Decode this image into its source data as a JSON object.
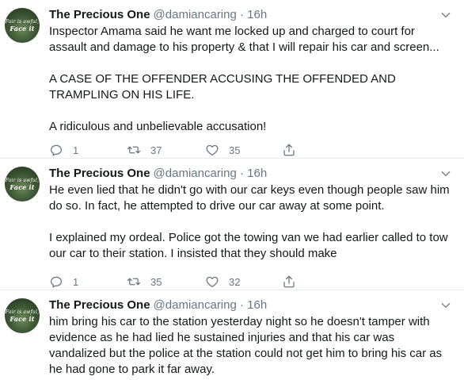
{
  "tweets": [
    {
      "name": "The Precious One",
      "handle": "@damiancaring",
      "separator": "·",
      "time": "16h",
      "paragraphs": [
        "Inspector Amama said he want me locked up and charged to court for assault and damage to his property & that I will repair his car and screen...",
        "A CASE OF THE OFFENDER ACCUSING THE OFFENDED AND TRAMPLING ON HIS LIFE.",
        "A ridiculous and unbelievable accusation!"
      ],
      "replies": "1",
      "retweets": "37",
      "likes": "35"
    },
    {
      "name": "The Precious One",
      "handle": "@damiancaring",
      "separator": "·",
      "time": "16h",
      "paragraphs": [
        "He even lied that he didn't go with our car keys even though people saw him do so. In fact, he attempted to drive our car away at some point.",
        "I explained my ordeal. Police got the towing van we had earlier called to tow our car to their station. I insisted that they should make"
      ],
      "replies": "1",
      "retweets": "35",
      "likes": "32"
    },
    {
      "name": "The Precious One",
      "handle": "@damiancaring",
      "separator": "·",
      "time": "16h",
      "paragraphs": [
        "him bring his car to the station yesterday night so he doesn't tamper with evidence as he had lied he sustained injuries and that his car was vandalized but the police at the station could not get him to bring his car as he had gone to park it far away."
      ]
    }
  ],
  "avatar": {
    "line1": "Fair is awful,",
    "line2": "Face it"
  },
  "icons": {
    "reply": "reply-icon",
    "retweet": "retweet-icon",
    "like": "heart-icon",
    "share": "share-icon",
    "more": "chevron-down-icon"
  },
  "colors": {
    "text": "#14171a",
    "muted": "#657786",
    "divider": "#e6ecf0"
  }
}
